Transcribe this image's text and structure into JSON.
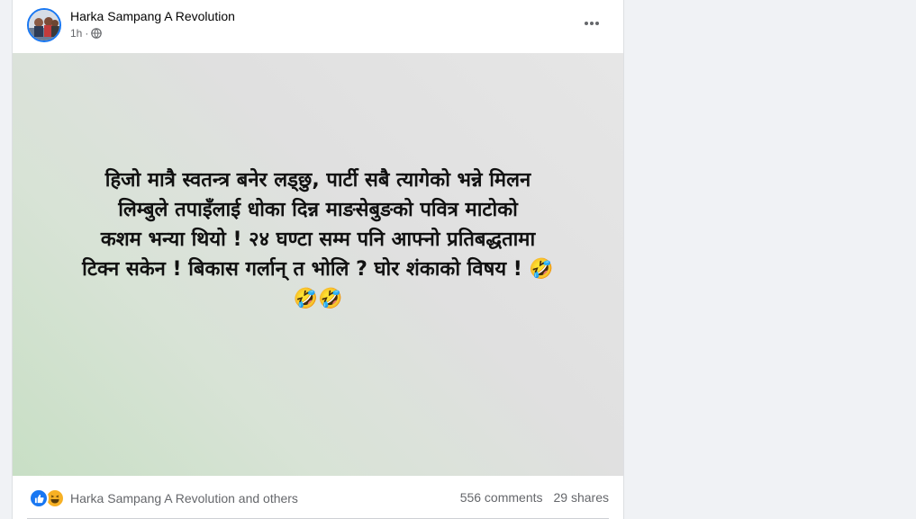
{
  "post": {
    "author": "Harka Sampang A Revolution",
    "time": "1h",
    "audience_icon": "globe-icon",
    "more_icon": "more-horizontal-icon",
    "text_lines": [
      "हिजो मात्रै स्वतन्त्र बनेर लड्छु, पार्टी सबै त्यागेको भन्ने मिलन",
      "लिम्बुले तपाइँलाई धोका दिन्न माङसेबुङको पवित्र माटोको",
      "कशम भन्या थियो ! २४ घण्टा सम्म पनि आफ्नो प्रतिबद्धतामा",
      "टिक्न सकेन ! बिकास गर्लान् त भोलि ? घोर शंकाको विषय ! 🤣",
      "🤣🤣"
    ],
    "background_colors": [
      "#c8dfc5",
      "#e6e6e6"
    ]
  },
  "footer": {
    "reaction_icons": [
      "like-icon",
      "haha-icon"
    ],
    "reactors": "Harka Sampang A Revolution and others",
    "comments": "556 comments",
    "shares": "29 shares"
  },
  "colors": {
    "accent": "#1877f2",
    "secondary_text": "#65676b",
    "page_bg": "#f0f2f5"
  }
}
